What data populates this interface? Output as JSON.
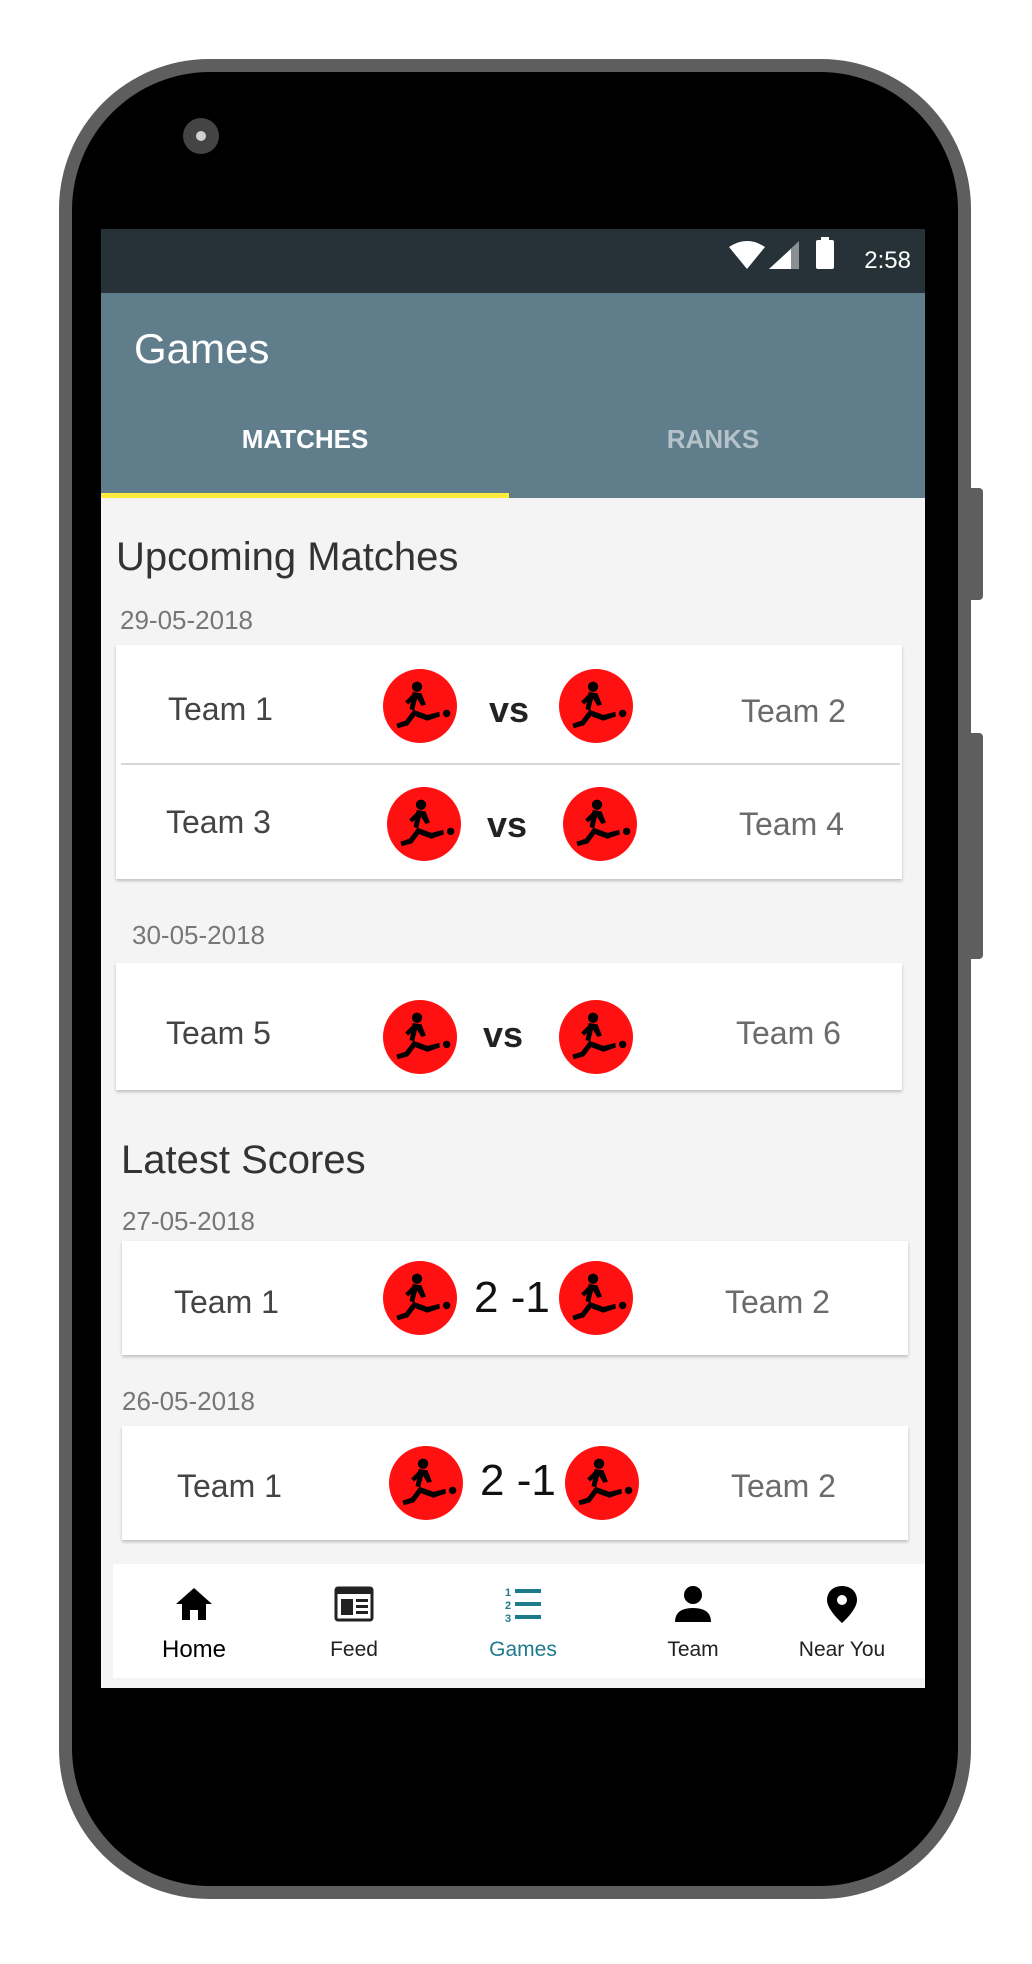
{
  "status_bar": {
    "time": "2:58"
  },
  "app_title": "Games",
  "tabs": [
    {
      "label": "MATCHES"
    },
    {
      "label": "RANKS"
    }
  ],
  "upcoming": {
    "title": "Upcoming Matches",
    "groups": [
      {
        "date": "29-05-2018",
        "matches": [
          {
            "home": "Team 1",
            "separator": "vs",
            "away": "Team 2"
          },
          {
            "home": "Team 3",
            "separator": "vs",
            "away": "Team 4"
          }
        ]
      },
      {
        "date": "30-05-2018",
        "matches": [
          {
            "home": "Team 5",
            "separator": "vs",
            "away": "Team 6"
          }
        ]
      }
    ]
  },
  "latest": {
    "title": "Latest Scores",
    "groups": [
      {
        "date": "27-05-2018",
        "home": "Team 1",
        "score": "2 -1",
        "away": "Team 2"
      },
      {
        "date": "26-05-2018",
        "home": "Team 1",
        "score": "2 -1",
        "away": "Team 2"
      }
    ]
  },
  "team_logo_icon": "soccer-kicker-icon",
  "colors": {
    "appbar": "#607d8b",
    "status_bar": "#263238",
    "tab_indicator": "#ffeb3b",
    "logo": "#ff1111",
    "nav_active": "#1f7a8c"
  },
  "bottom_nav": [
    {
      "label": "Home",
      "icon": "home-icon"
    },
    {
      "label": "Feed",
      "icon": "feed-icon"
    },
    {
      "label": "Games",
      "icon": "games-list-icon",
      "active": true
    },
    {
      "label": "Team",
      "icon": "person-icon"
    },
    {
      "label": "Near You",
      "icon": "location-pin-icon"
    }
  ]
}
